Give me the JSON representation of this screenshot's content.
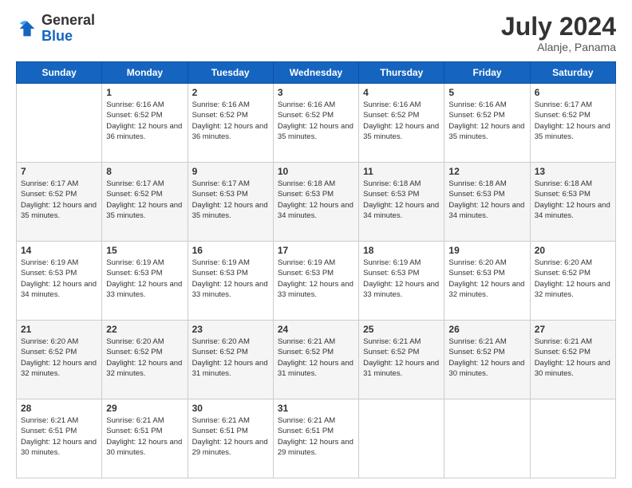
{
  "logo": {
    "general": "General",
    "blue": "Blue"
  },
  "header": {
    "month": "July 2024",
    "location": "Alanje, Panama"
  },
  "days_of_week": [
    "Sunday",
    "Monday",
    "Tuesday",
    "Wednesday",
    "Thursday",
    "Friday",
    "Saturday"
  ],
  "weeks": [
    [
      {
        "day": "",
        "info": ""
      },
      {
        "day": "1",
        "info": "Sunrise: 6:16 AM\nSunset: 6:52 PM\nDaylight: 12 hours\nand 36 minutes."
      },
      {
        "day": "2",
        "info": "Sunrise: 6:16 AM\nSunset: 6:52 PM\nDaylight: 12 hours\nand 36 minutes."
      },
      {
        "day": "3",
        "info": "Sunrise: 6:16 AM\nSunset: 6:52 PM\nDaylight: 12 hours\nand 35 minutes."
      },
      {
        "day": "4",
        "info": "Sunrise: 6:16 AM\nSunset: 6:52 PM\nDaylight: 12 hours\nand 35 minutes."
      },
      {
        "day": "5",
        "info": "Sunrise: 6:16 AM\nSunset: 6:52 PM\nDaylight: 12 hours\nand 35 minutes."
      },
      {
        "day": "6",
        "info": "Sunrise: 6:17 AM\nSunset: 6:52 PM\nDaylight: 12 hours\nand 35 minutes."
      }
    ],
    [
      {
        "day": "7",
        "info": "Sunrise: 6:17 AM\nSunset: 6:52 PM\nDaylight: 12 hours\nand 35 minutes."
      },
      {
        "day": "8",
        "info": "Sunrise: 6:17 AM\nSunset: 6:52 PM\nDaylight: 12 hours\nand 35 minutes."
      },
      {
        "day": "9",
        "info": "Sunrise: 6:17 AM\nSunset: 6:53 PM\nDaylight: 12 hours\nand 35 minutes."
      },
      {
        "day": "10",
        "info": "Sunrise: 6:18 AM\nSunset: 6:53 PM\nDaylight: 12 hours\nand 34 minutes."
      },
      {
        "day": "11",
        "info": "Sunrise: 6:18 AM\nSunset: 6:53 PM\nDaylight: 12 hours\nand 34 minutes."
      },
      {
        "day": "12",
        "info": "Sunrise: 6:18 AM\nSunset: 6:53 PM\nDaylight: 12 hours\nand 34 minutes."
      },
      {
        "day": "13",
        "info": "Sunrise: 6:18 AM\nSunset: 6:53 PM\nDaylight: 12 hours\nand 34 minutes."
      }
    ],
    [
      {
        "day": "14",
        "info": "Sunrise: 6:19 AM\nSunset: 6:53 PM\nDaylight: 12 hours\nand 34 minutes."
      },
      {
        "day": "15",
        "info": "Sunrise: 6:19 AM\nSunset: 6:53 PM\nDaylight: 12 hours\nand 33 minutes."
      },
      {
        "day": "16",
        "info": "Sunrise: 6:19 AM\nSunset: 6:53 PM\nDaylight: 12 hours\nand 33 minutes."
      },
      {
        "day": "17",
        "info": "Sunrise: 6:19 AM\nSunset: 6:53 PM\nDaylight: 12 hours\nand 33 minutes."
      },
      {
        "day": "18",
        "info": "Sunrise: 6:19 AM\nSunset: 6:53 PM\nDaylight: 12 hours\nand 33 minutes."
      },
      {
        "day": "19",
        "info": "Sunrise: 6:20 AM\nSunset: 6:53 PM\nDaylight: 12 hours\nand 32 minutes."
      },
      {
        "day": "20",
        "info": "Sunrise: 6:20 AM\nSunset: 6:52 PM\nDaylight: 12 hours\nand 32 minutes."
      }
    ],
    [
      {
        "day": "21",
        "info": "Sunrise: 6:20 AM\nSunset: 6:52 PM\nDaylight: 12 hours\nand 32 minutes."
      },
      {
        "day": "22",
        "info": "Sunrise: 6:20 AM\nSunset: 6:52 PM\nDaylight: 12 hours\nand 32 minutes."
      },
      {
        "day": "23",
        "info": "Sunrise: 6:20 AM\nSunset: 6:52 PM\nDaylight: 12 hours\nand 31 minutes."
      },
      {
        "day": "24",
        "info": "Sunrise: 6:21 AM\nSunset: 6:52 PM\nDaylight: 12 hours\nand 31 minutes."
      },
      {
        "day": "25",
        "info": "Sunrise: 6:21 AM\nSunset: 6:52 PM\nDaylight: 12 hours\nand 31 minutes."
      },
      {
        "day": "26",
        "info": "Sunrise: 6:21 AM\nSunset: 6:52 PM\nDaylight: 12 hours\nand 30 minutes."
      },
      {
        "day": "27",
        "info": "Sunrise: 6:21 AM\nSunset: 6:52 PM\nDaylight: 12 hours\nand 30 minutes."
      }
    ],
    [
      {
        "day": "28",
        "info": "Sunrise: 6:21 AM\nSunset: 6:51 PM\nDaylight: 12 hours\nand 30 minutes."
      },
      {
        "day": "29",
        "info": "Sunrise: 6:21 AM\nSunset: 6:51 PM\nDaylight: 12 hours\nand 30 minutes."
      },
      {
        "day": "30",
        "info": "Sunrise: 6:21 AM\nSunset: 6:51 PM\nDaylight: 12 hours\nand 29 minutes."
      },
      {
        "day": "31",
        "info": "Sunrise: 6:21 AM\nSunset: 6:51 PM\nDaylight: 12 hours\nand 29 minutes."
      },
      {
        "day": "",
        "info": ""
      },
      {
        "day": "",
        "info": ""
      },
      {
        "day": "",
        "info": ""
      }
    ]
  ]
}
